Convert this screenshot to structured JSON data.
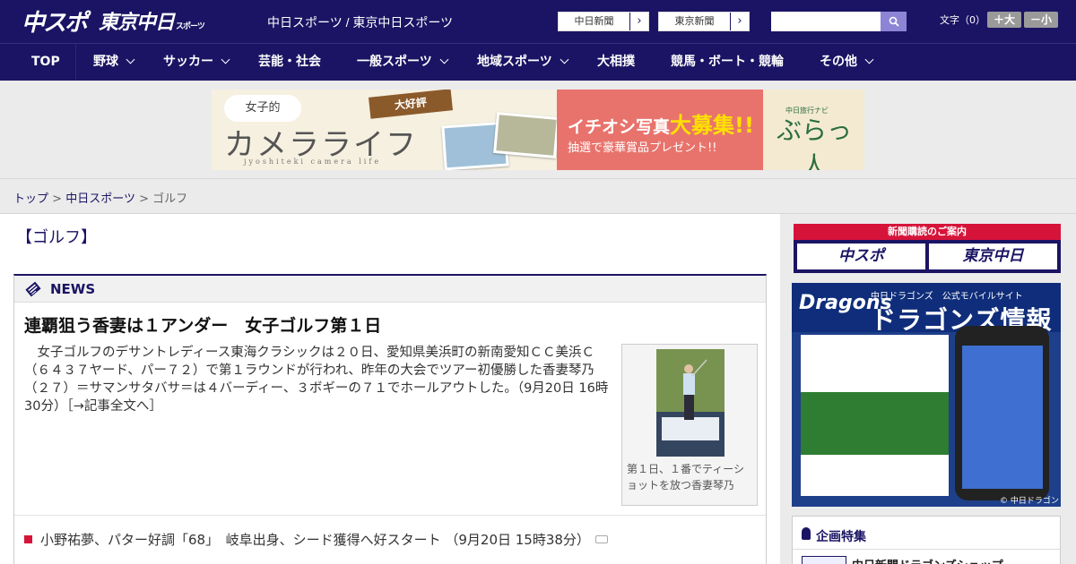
{
  "header": {
    "logo_chuspo": "中スポ",
    "logo_tokyo": "東京中日",
    "logo_tokyo_small": "スポーツ",
    "site_links": "中日スポーツ / 東京中日スポーツ",
    "paper_buttons": [
      "中日新聞",
      "東京新聞"
    ],
    "search_placeholder": "",
    "font_size_label": "文字（0）",
    "font_plus": "＋大",
    "font_minus": "－小"
  },
  "nav": {
    "items": [
      "TOP",
      "野球",
      "サッカー",
      "芸能・社会",
      "一般スポーツ",
      "地域スポーツ",
      "大相撲",
      "競馬・ボート・競輪",
      "その他"
    ]
  },
  "banner": {
    "bubble": "女子的",
    "title": "カメラライフ",
    "subtitle_en": "jyoshiteki camera life",
    "ribbon": "大好評",
    "line1_pre": "イチオシ写真",
    "line1_big": "大募集!!",
    "line2": "抽選で豪華賞品プレゼント!!",
    "brand_small": "中日旅行ナビ",
    "brand": "ぶらっ人"
  },
  "breadcrumb": {
    "home": "トップ",
    "section": "中日スポーツ",
    "current": "ゴルフ",
    "sep": ">"
  },
  "page": {
    "title": "【ゴルフ】"
  },
  "news": {
    "label": "NEWS",
    "headline": "連覇狙う香妻は１アンダー　女子ゴルフ第１日",
    "body": "　女子ゴルフのデサントレディース東海クラシックは２０日、愛知県美浜町の新南愛知ＣＣ美浜Ｃ（６４３７ヤード、パー７２）で第１ラウンドが行われ、昨年の大会でツアー初優勝した香妻琴乃（２７）＝サマンサタバサ＝は４バーディー、３ボギーの７１でホールアウトした。（9月20日 16時30分）［→記事全文へ］",
    "photo_caption": "第１日、１番でティーショットを放つ香妻琴乃",
    "list": [
      "小野祐夢、パター好調「68」　岐阜出身、シード獲得へ好スタート （9月20日 15時38分）"
    ]
  },
  "sidebar": {
    "subscribe_head": "新聞購読のご案内",
    "subscribe_buttons": [
      "中スポ",
      "東京中日"
    ],
    "dragons_logo": "Dragons",
    "dragons_small": "中日ドラゴンズ　公式モバイルサイト",
    "dragons_big": "ドラゴンズ情報",
    "dragons_copy": "© 中日ドラゴンズ",
    "feature_title": "企画特集",
    "feature_item": "中日新聞ドラゴンズショップ"
  },
  "colors": {
    "navy": "#1b1464",
    "red": "#d6143a"
  }
}
